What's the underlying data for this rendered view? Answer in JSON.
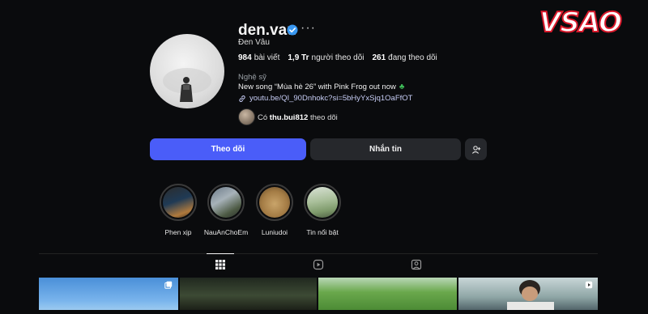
{
  "watermark": {
    "part1": "VS",
    "part2": "AO"
  },
  "profile": {
    "username": "den.vau",
    "more_glyph": "···",
    "full_name": "Đen Vâu",
    "stats": [
      {
        "value": "984",
        "label": "bài viết"
      },
      {
        "value": "1,9 Tr",
        "label": "người theo dõi"
      },
      {
        "value": "261",
        "label": "đang theo dõi"
      }
    ],
    "category": "Nghệ sỹ",
    "bio": "New song “Mùa hè 26” with Pink Frog out now",
    "bio_emoji": "♣",
    "link": "youtu.be/QI_90Dnhokc?si=5bHyYxSjq1OaFfOT",
    "followed_by_prefix": "Có",
    "followed_by_user": "thu.bui812",
    "followed_by_suffix": "theo dõi"
  },
  "actions": {
    "follow_label": "Theo dõi",
    "message_label": "Nhắn tin"
  },
  "highlights": [
    {
      "label": "Phen xịp"
    },
    {
      "label": "NauAnChoEm"
    },
    {
      "label": "Luniudoi"
    },
    {
      "label": "Tin nổi bật"
    }
  ],
  "tabs": [
    "posts-grid-icon",
    "reels-icon",
    "tagged-icon"
  ],
  "colors": {
    "background": "#0a0b0d",
    "follow_button": "#4a5df9",
    "secondary_button": "#26282c",
    "link_text": "#c7cdf5",
    "verified_badge": "#3897f0"
  }
}
